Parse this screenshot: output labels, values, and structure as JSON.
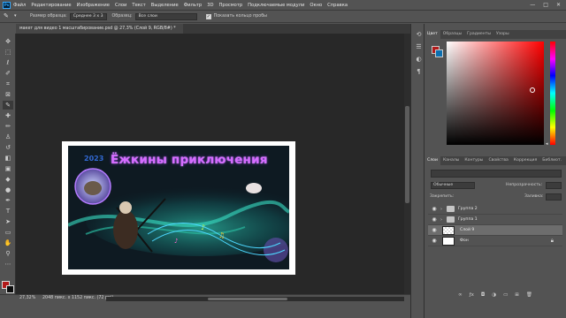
{
  "menubar": {
    "logo": "Ps",
    "items": [
      "Файл",
      "Редактирование",
      "Изображение",
      "Слои",
      "Текст",
      "Выделение",
      "Фильтр",
      "3D",
      "Просмотр",
      "Подключаемые модули",
      "Окно",
      "Справка"
    ],
    "window_controls": [
      "—",
      "□",
      "✕"
    ]
  },
  "options_bar": {
    "sample_size_label": "Размер образца:",
    "sample_size_value": "Среднее 3 x 3",
    "sample_label": "Образец:",
    "sample_value": "Все слои",
    "show_ring_label": "Показать кольцо пробы",
    "show_ring_checked": true
  },
  "document": {
    "tab_title": "макет для видео 1 масштабирование.psd @ 27,3% (Слой 9, RGB/8#) *",
    "art_title": "Ёжкины приключения",
    "art_year": "2023"
  },
  "status": {
    "zoom": "27,32%",
    "doc_info": "2048 пикс. x 1152 пикс. (72 ppi)"
  },
  "colors": {
    "foreground": "#b21a1a",
    "background": "#0c0c0c",
    "picker_foreground": "#b21a1a",
    "picker_background": "#0c6fb0",
    "title_glow": "#d66cff"
  },
  "color_panel": {
    "tabs": [
      "Цвет",
      "Образцы",
      "Градиенты",
      "Узоры"
    ],
    "active_tab": "Цвет"
  },
  "layers_panel": {
    "tabs": [
      "Слои",
      "Каналы",
      "Контуры",
      "Свойства",
      "Коррекция",
      "Библиот."
    ],
    "active_tab": "Слои",
    "kind_filter": "Обычные",
    "opacity_label": "Непрозрачность:",
    "lock_label": "Закрепить:",
    "fill_label": "Заливка:",
    "layers": [
      {
        "name": "Группа 2",
        "type": "group",
        "visible": true
      },
      {
        "name": "Группа 1",
        "type": "group",
        "visible": true
      },
      {
        "name": "Слой 9",
        "type": "layer",
        "visible": true,
        "selected": true
      },
      {
        "name": "Фон",
        "type": "background",
        "visible": true,
        "locked": true
      }
    ],
    "footer_icons": [
      "link-icon",
      "fx-icon",
      "mask-icon",
      "adjustment-icon",
      "folder-icon",
      "new-layer-icon",
      "trash-icon"
    ]
  },
  "tools": [
    "move-tool",
    "marquee-tool",
    "lasso-tool",
    "quick-select-tool",
    "crop-tool",
    "frame-tool",
    "eyedropper-tool",
    "healing-tool",
    "brush-tool",
    "stamp-tool",
    "history-brush-tool",
    "eraser-tool",
    "gradient-tool",
    "blur-tool",
    "dodge-tool",
    "pen-tool",
    "type-tool",
    "path-select-tool",
    "shape-tool",
    "hand-tool",
    "zoom-tool",
    "more-tools"
  ]
}
